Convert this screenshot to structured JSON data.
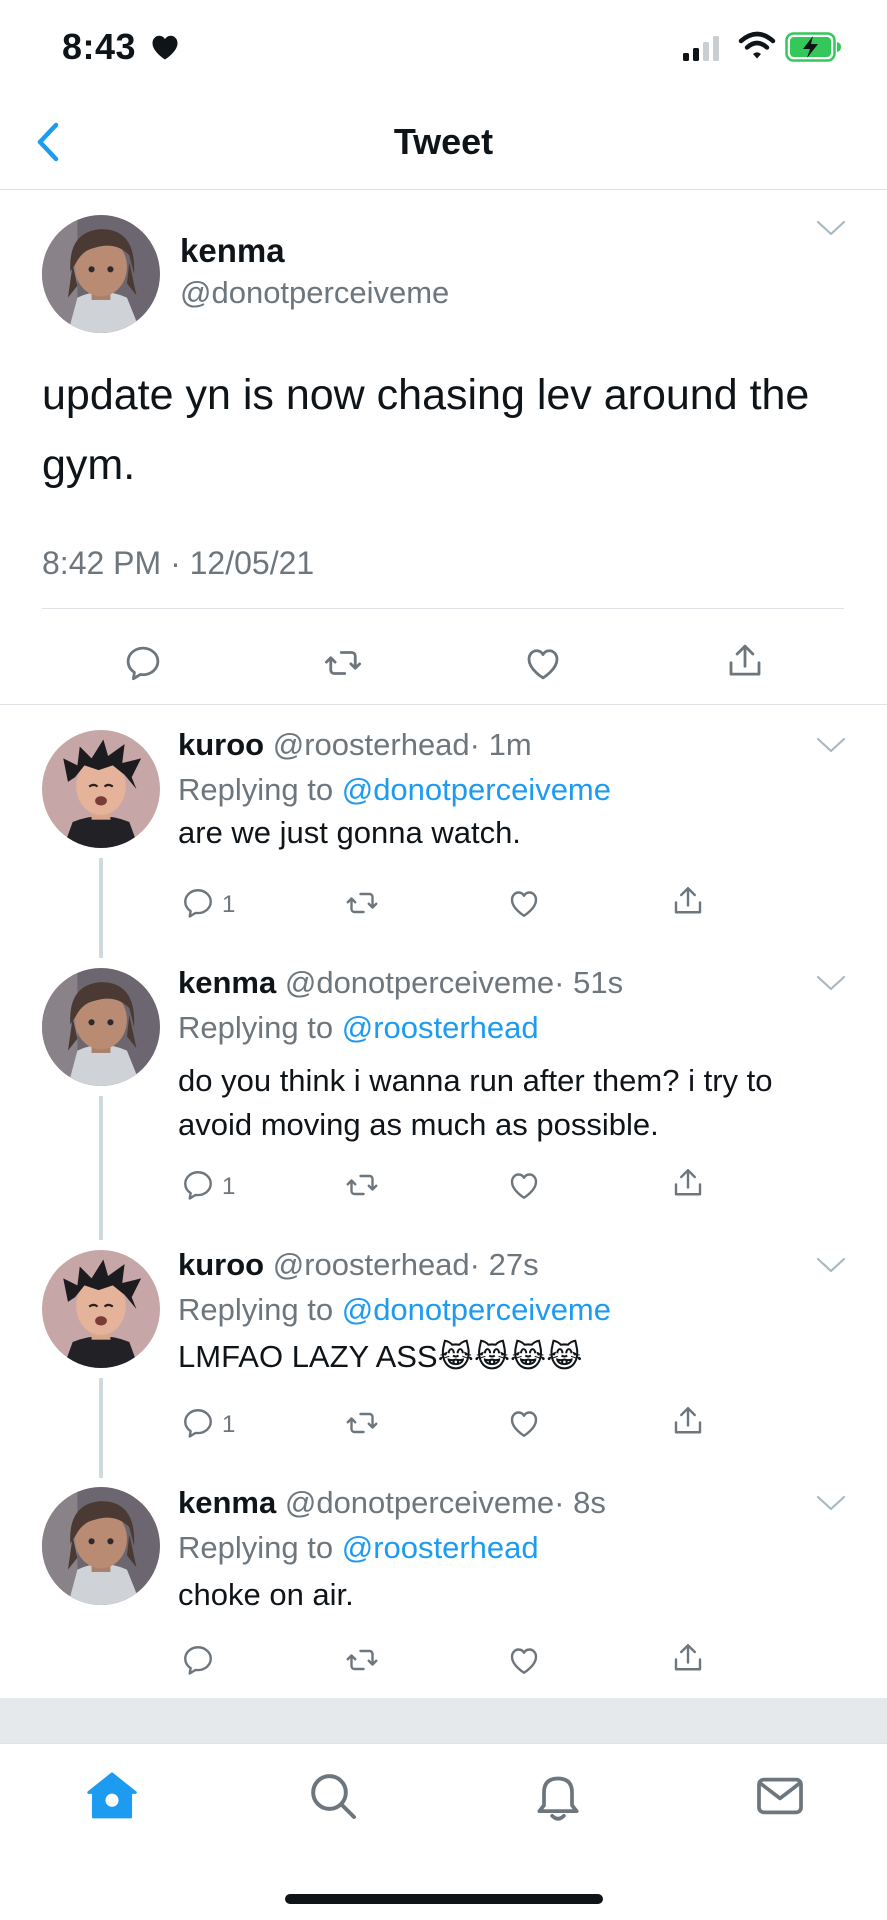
{
  "status_bar": {
    "time": "8:43",
    "battery_color": "#34c759"
  },
  "header": {
    "title": "Tweet"
  },
  "main_tweet": {
    "name": "kenma",
    "handle": "@donotperceiveme",
    "text": "update yn is now chasing lev around the gym.",
    "timestamp": "8:42 PM · 12/05/21",
    "avatar": "kenma-avatar"
  },
  "replies": [
    {
      "name": "kuroo",
      "handle": "@roosterhead",
      "time": "· 1m",
      "replying_prefix": "Replying to ",
      "replying_to": "@donotperceiveme",
      "text": "are we just gonna watch.",
      "reply_count": "1",
      "avatar": "kuroo-avatar"
    },
    {
      "name": "kenma",
      "handle": "@donotperceiveme",
      "time": "· 51s",
      "replying_prefix": "Replying to ",
      "replying_to": "@roosterhead",
      "text": "do you think i wanna run after them? i try to avoid moving as much as possible.",
      "reply_count": "1",
      "avatar": "kenma-avatar"
    },
    {
      "name": "kuroo",
      "handle": "@roosterhead",
      "time": "· 27s",
      "replying_prefix": "Replying to ",
      "replying_to": "@donotperceiveme",
      "text": "LMFAO LAZY ASS😹😹😹😹",
      "reply_count": "1",
      "avatar": "kuroo-avatar"
    },
    {
      "name": "kenma",
      "handle": "@donotperceiveme",
      "time": "· 8s",
      "replying_prefix": "Replying to ",
      "replying_to": "@roosterhead",
      "text": "choke on air.",
      "reply_count": "",
      "avatar": "kenma-avatar"
    }
  ],
  "colors": {
    "accent": "#1d9bf0",
    "secondary_text": "#6e767d",
    "divider": "#dfe3e7"
  },
  "tab_bar": {
    "tabs": [
      "home-icon",
      "search-icon",
      "bell-icon",
      "mail-icon"
    ],
    "active": "home-icon"
  }
}
